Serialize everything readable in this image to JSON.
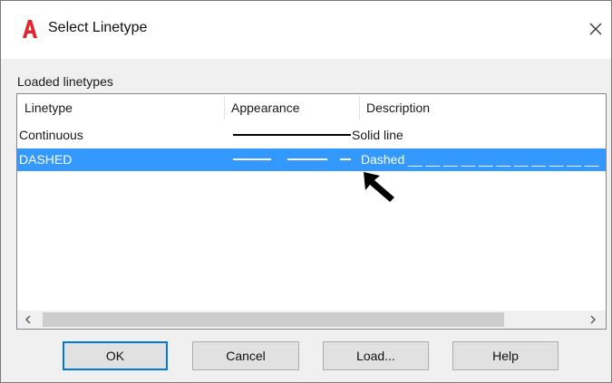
{
  "window": {
    "title": "Select Linetype"
  },
  "icons": {
    "app": "autocad-logo-icon",
    "close": "close-icon",
    "pointer": "arrow-pointer-icon",
    "scroll_left": "chevron-left-icon",
    "scroll_right": "chevron-right-icon"
  },
  "colors": {
    "selection": "#3399ff",
    "app_red": "#e0262b",
    "default_button_border": "#0078d7"
  },
  "loaded_linetypes": {
    "label": "Loaded linetypes",
    "columns": [
      "Linetype",
      "Appearance",
      "Description"
    ],
    "rows": [
      {
        "linetype": "Continuous",
        "appearance": "solid",
        "description": "Solid line",
        "selected": false
      },
      {
        "linetype": "DASHED",
        "appearance": "dashed",
        "description": "Dashed __ __ __ __ __ __ __ __ __ __ __",
        "selected": true
      }
    ]
  },
  "buttons": {
    "ok": "OK",
    "cancel": "Cancel",
    "load": "Load...",
    "help": "Help"
  }
}
